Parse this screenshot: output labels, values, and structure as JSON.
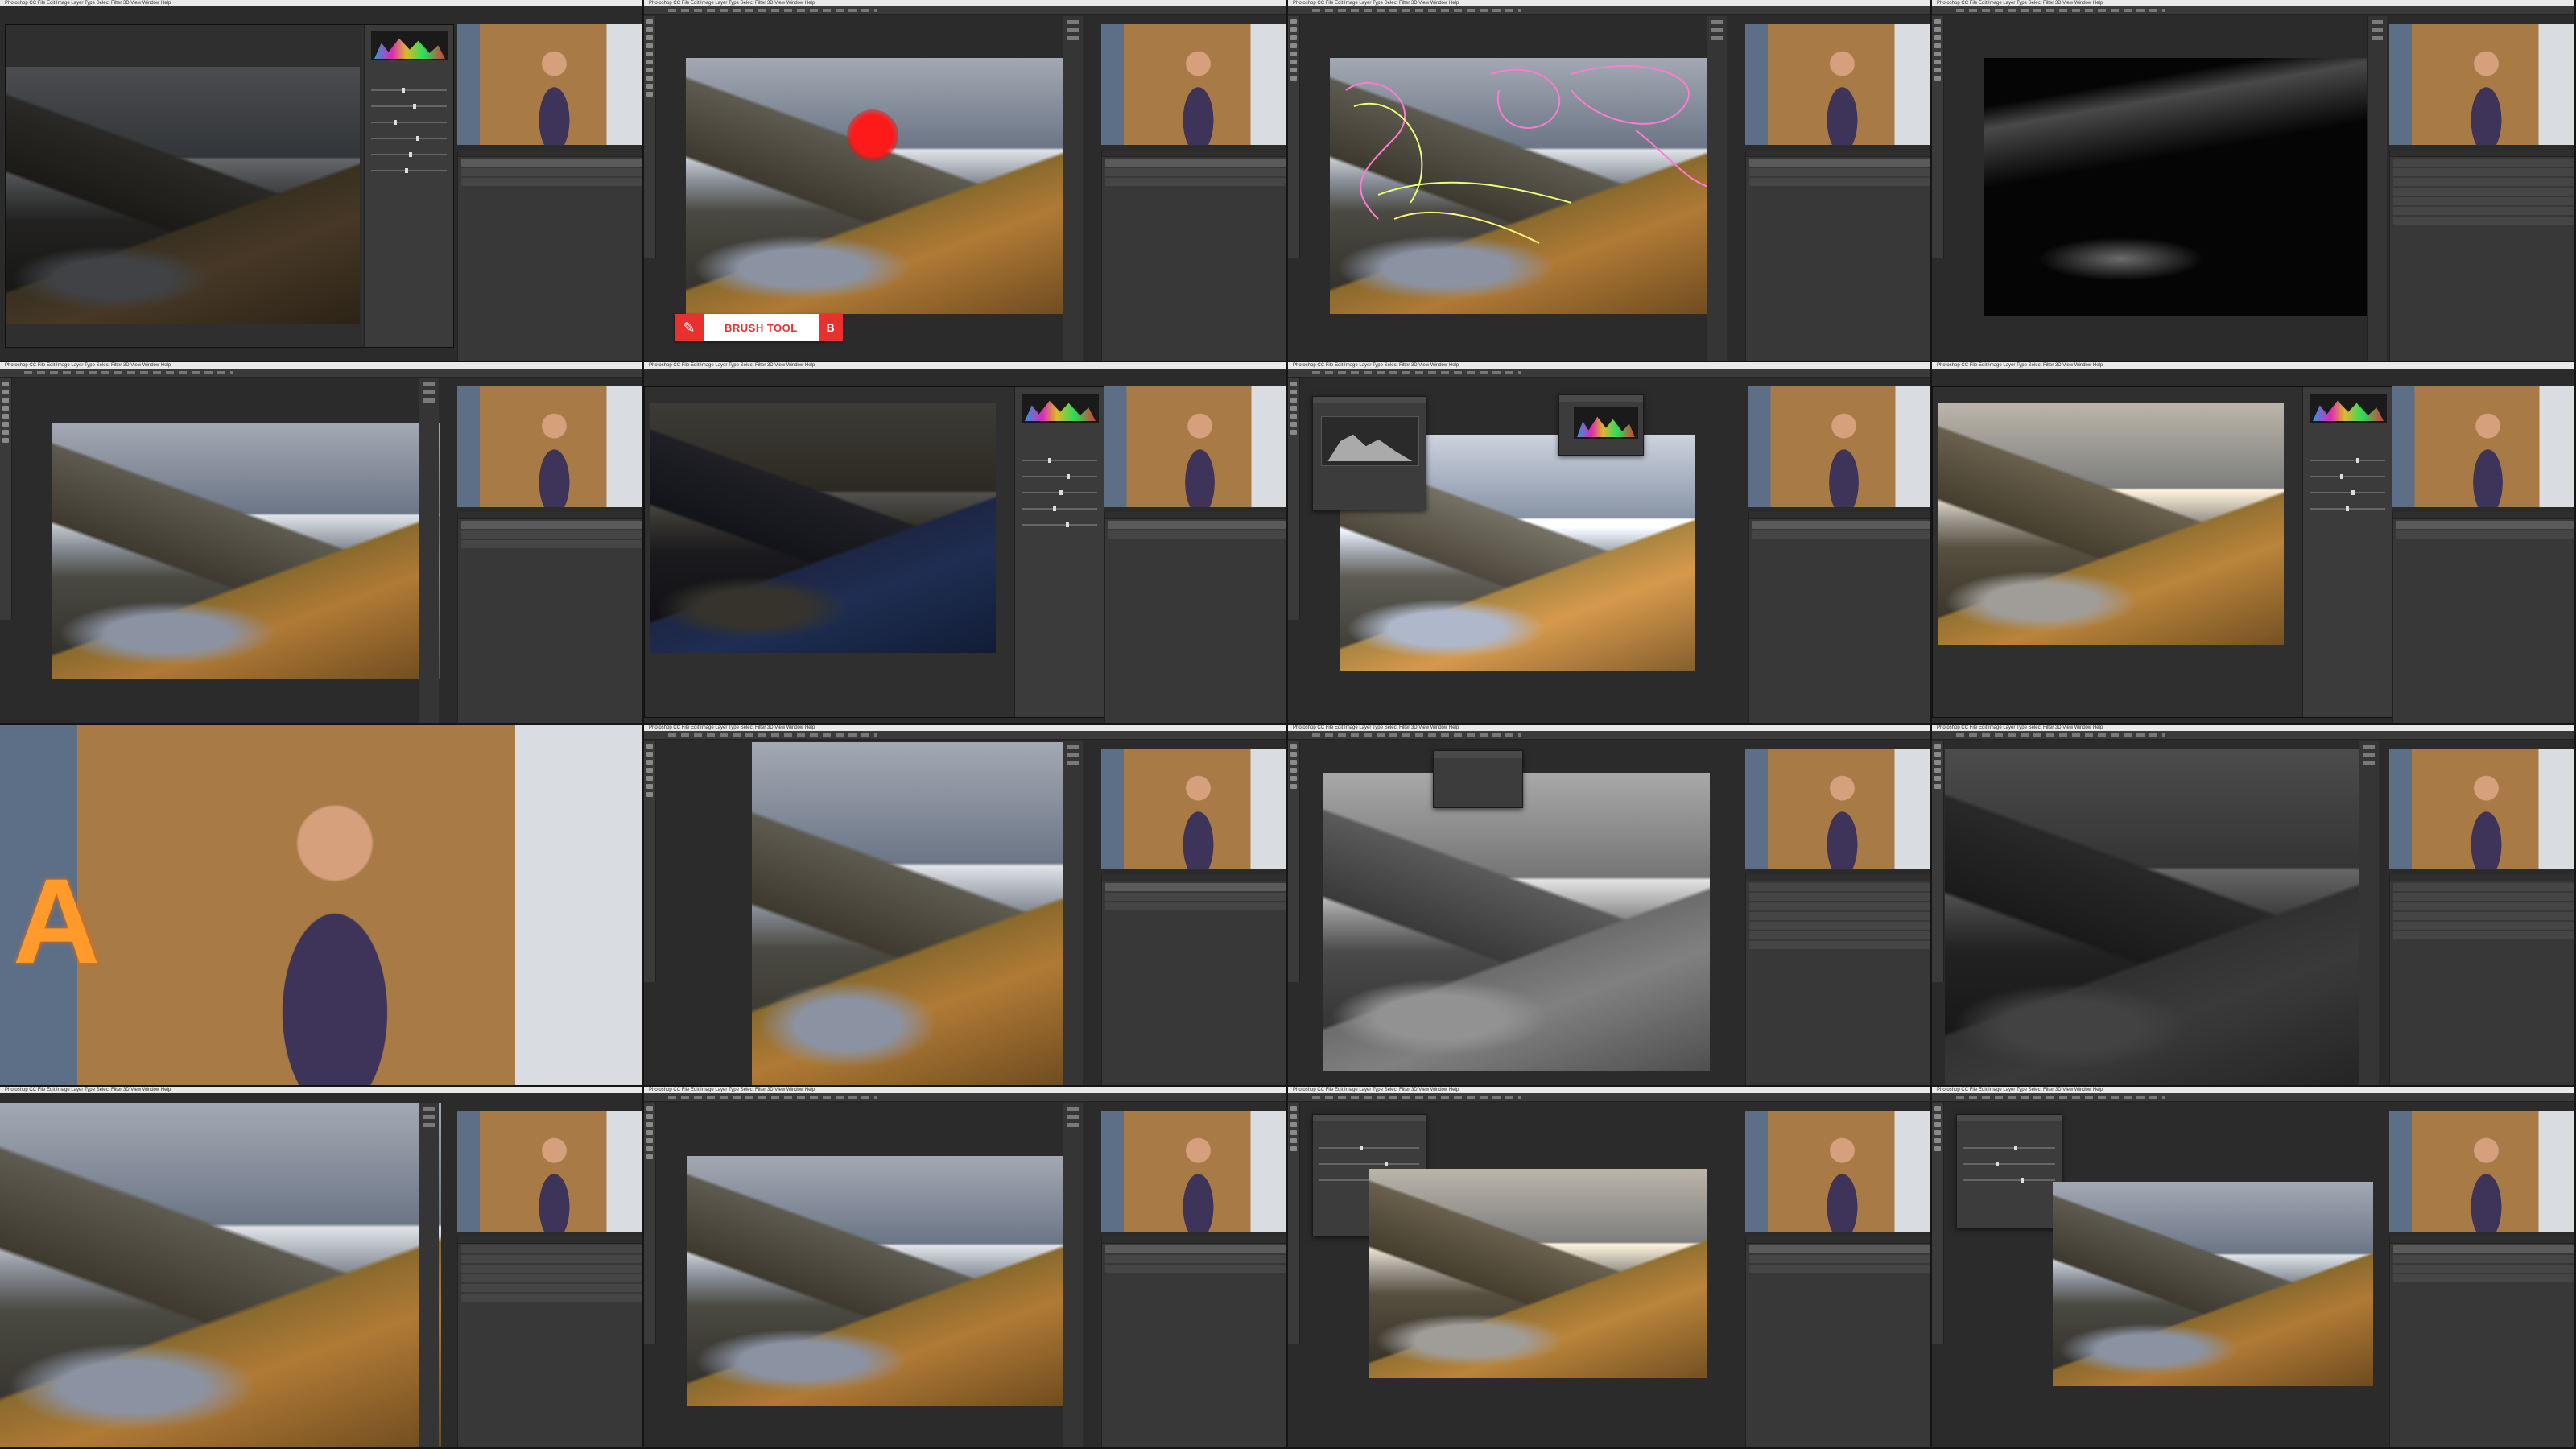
{
  "collage": {
    "rows": 4,
    "cols": 4
  },
  "menu_text": "Photoshop CC   File   Edit   Image   Layer   Type   Select   Filter   3D   View   Window   Help",
  "brush_overlay": {
    "label": "BRUSH TOOL",
    "shortcut": "B",
    "icon": "brush-icon",
    "accent": "#e8302e"
  },
  "cells": [
    {
      "id": "r1c1",
      "kind": "camera-raw",
      "image": "dark"
    },
    {
      "id": "r1c2",
      "kind": "brush-demo",
      "image": "normal"
    },
    {
      "id": "r1c3",
      "kind": "scribble",
      "image": "normal"
    },
    {
      "id": "r1c4",
      "kind": "mask",
      "image": "black"
    },
    {
      "id": "r2c1",
      "kind": "photoshop",
      "image": "normal"
    },
    {
      "id": "r2c2",
      "kind": "camera-raw",
      "image": "night"
    },
    {
      "id": "r2c3",
      "kind": "levels",
      "image": "bright"
    },
    {
      "id": "r2c4",
      "kind": "camera-raw",
      "image": "warm"
    },
    {
      "id": "r3c1",
      "kind": "presenter",
      "image": "presenter"
    },
    {
      "id": "r3c2",
      "kind": "photoshop",
      "image": "normal"
    },
    {
      "id": "r3c3",
      "kind": "dialog",
      "image": "bw"
    },
    {
      "id": "r3c4",
      "kind": "photoshop",
      "image": "bwdark"
    },
    {
      "id": "r4c1",
      "kind": "photoshop",
      "image": "normal"
    },
    {
      "id": "r4c2",
      "kind": "photoshop",
      "image": "normal"
    },
    {
      "id": "r4c3",
      "kind": "properties",
      "image": "warm"
    },
    {
      "id": "r4c4",
      "kind": "properties",
      "image": "normal"
    }
  ]
}
